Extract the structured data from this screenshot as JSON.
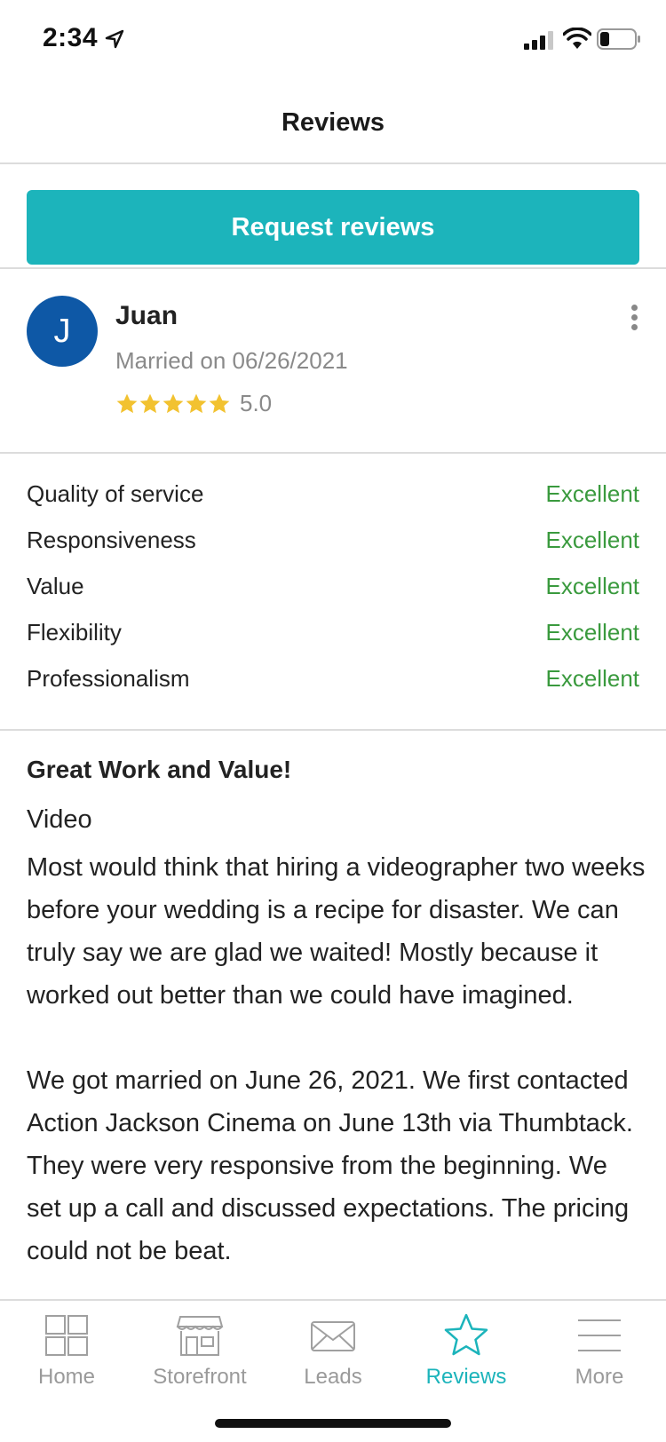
{
  "status_bar": {
    "time": "2:34"
  },
  "header": {
    "title": "Reviews"
  },
  "request_button": {
    "label": "Request reviews"
  },
  "reviewer": {
    "initial": "J",
    "name": "Juan",
    "date": "Married on 06/26/2021",
    "stars": 5,
    "rating": "5.0"
  },
  "ratings": [
    {
      "label": "Quality of service",
      "value": "Excellent"
    },
    {
      "label": "Responsiveness",
      "value": "Excellent"
    },
    {
      "label": "Value",
      "value": "Excellent"
    },
    {
      "label": "Flexibility",
      "value": "Excellent"
    },
    {
      "label": "Professionalism",
      "value": "Excellent"
    }
  ],
  "review": {
    "title": "Great Work and Value!",
    "category": "Video",
    "paragraph_1": "Most would think that hiring a videographer two weeks before your wedding is a recipe for disaster. We can truly say we are glad we waited! Mostly because it worked out better than we could have imagined.",
    "paragraph_2": "We got married on June 26, 2021. We first contacted Action Jackson Cinema on June 13th via Thumbtack. They were very responsive from the beginning. We set up a call and discussed expectations. The pricing could not be beat."
  },
  "tabs": [
    {
      "label": "Home",
      "icon": "grid-icon"
    },
    {
      "label": "Storefront",
      "icon": "storefront-icon"
    },
    {
      "label": "Leads",
      "icon": "envelope-icon"
    },
    {
      "label": "Reviews",
      "icon": "star-icon"
    },
    {
      "label": "More",
      "icon": "menu-icon"
    }
  ],
  "colors": {
    "accent": "#1cb4bb",
    "avatar": "#0e58a6",
    "star": "#f2c230",
    "excellent": "#3a9a3e"
  }
}
